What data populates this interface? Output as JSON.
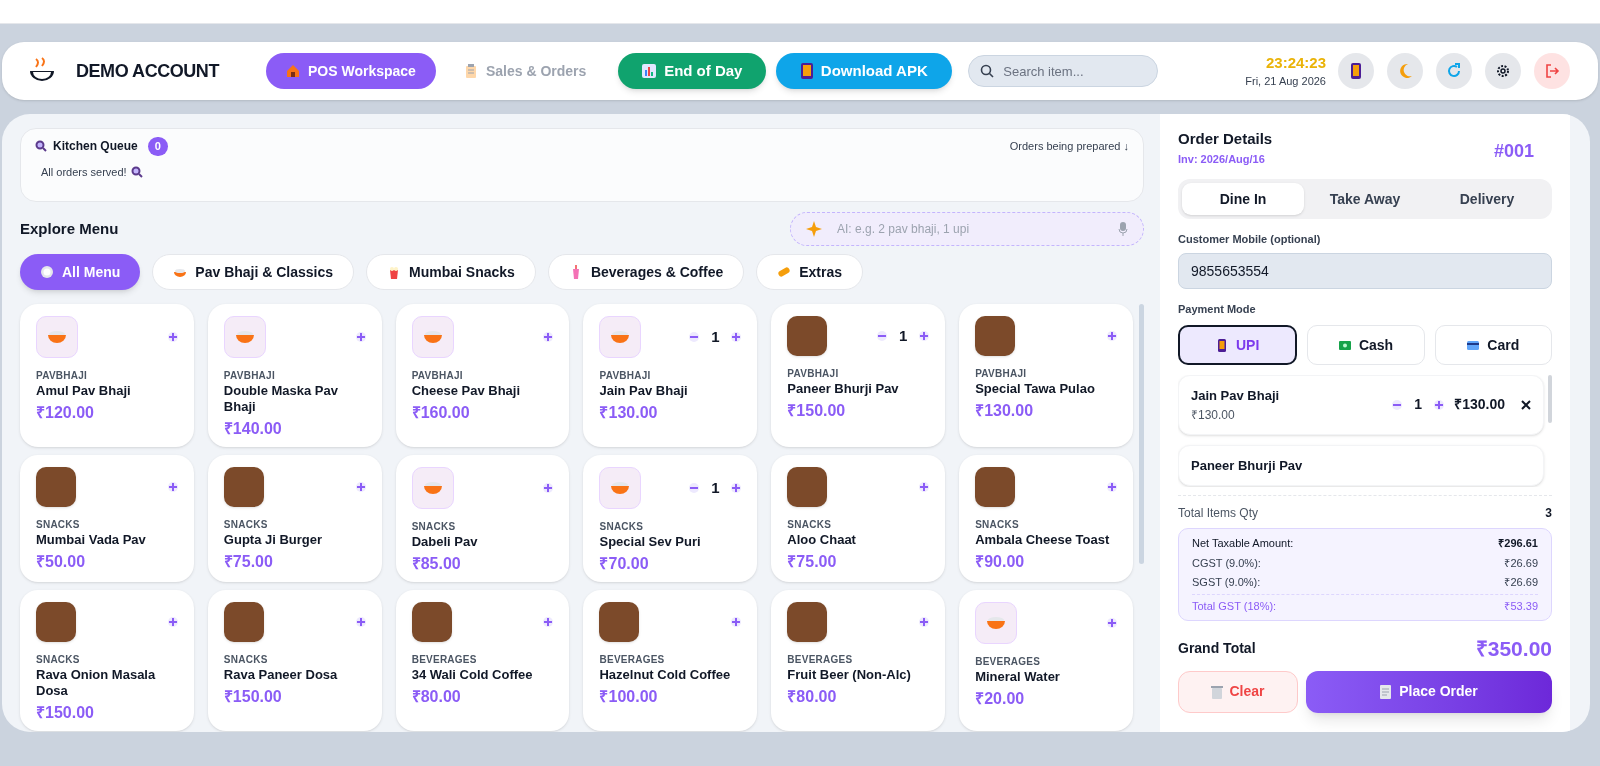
{
  "header": {
    "account_name": "DEMO ACCOUNT",
    "nav": [
      {
        "label": "POS Workspace",
        "selected": true
      },
      {
        "label": "Sales & Orders",
        "selected": false
      }
    ],
    "actions": [
      {
        "label": "End of Day",
        "kind": "green"
      },
      {
        "label": "Download APK",
        "kind": "blue"
      }
    ],
    "search": {
      "placeholder": "Search item..."
    },
    "clock": {
      "time": "23:24:23",
      "date": "Fri, 21 Aug 2026"
    }
  },
  "kitchen_queue": {
    "title": "Kitchen Queue",
    "count": "0",
    "status": "All orders served!",
    "hint": "Orders being prepared ↓"
  },
  "menu": {
    "title": "Explore Menu",
    "ai_input": {
      "placeholder": "AI: e.g. 2 pav bhaji, 1 upi"
    },
    "categories": [
      {
        "label": "All Menu",
        "selected": true
      },
      {
        "label": "Pav Bhaji & Classics",
        "selected": false
      },
      {
        "label": "Mumbai Snacks",
        "selected": false
      },
      {
        "label": "Beverages & Coffee",
        "selected": false
      },
      {
        "label": "Extras",
        "selected": false
      }
    ],
    "items": [
      {
        "category": "PAVBHAJI",
        "name": "Amul Pav Bhaji",
        "price": "₹120.00",
        "kind": "icon"
      },
      {
        "category": "PAVBHAJI",
        "name": "Double Maska Pav Bhaji",
        "price": "₹140.00",
        "kind": "icon"
      },
      {
        "category": "PAVBHAJI",
        "name": "Cheese Pav Bhaji",
        "price": "₹160.00",
        "kind": "icon"
      },
      {
        "category": "PAVBHAJI",
        "name": "Jain Pav Bhaji",
        "price": "₹130.00",
        "kind": "icon",
        "quantity": "1"
      },
      {
        "category": "PAVBHAJI",
        "name": "Paneer Bhurji Pav",
        "price": "₹150.00",
        "kind": "photo",
        "quantity": "1"
      },
      {
        "category": "PAVBHAJI",
        "name": "Special Tawa Pulao",
        "price": "₹130.00",
        "kind": "photo"
      },
      {
        "category": "SNACKS",
        "name": "Mumbai Vada Pav",
        "price": "₹50.00",
        "kind": "photo"
      },
      {
        "category": "SNACKS",
        "name": "Gupta Ji Burger",
        "price": "₹75.00",
        "kind": "photo"
      },
      {
        "category": "SNACKS",
        "name": "Dabeli Pav",
        "price": "₹85.00",
        "kind": "icon"
      },
      {
        "category": "SNACKS",
        "name": "Special Sev Puri",
        "price": "₹70.00",
        "kind": "icon",
        "quantity": "1"
      },
      {
        "category": "SNACKS",
        "name": "Aloo Chaat",
        "price": "₹75.00",
        "kind": "photo"
      },
      {
        "category": "SNACKS",
        "name": "Ambala Cheese Toast",
        "price": "₹90.00",
        "kind": "photo"
      },
      {
        "category": "SNACKS",
        "name": "Rava Onion Masala Dosa",
        "price": "₹150.00",
        "kind": "photo"
      },
      {
        "category": "SNACKS",
        "name": "Rava Paneer Dosa",
        "price": "₹150.00",
        "kind": "photo"
      },
      {
        "category": "BEVERAGES",
        "name": "34 Wali Cold Coffee",
        "price": "₹80.00",
        "kind": "photo"
      },
      {
        "category": "BEVERAGES",
        "name": "Hazelnut Cold Coffee",
        "price": "₹100.00",
        "kind": "photo"
      },
      {
        "category": "BEVERAGES",
        "name": "Fruit Beer (Non-Alc)",
        "price": "₹80.00",
        "kind": "photo"
      },
      {
        "category": "BEVERAGES",
        "name": "Mineral Water",
        "price": "₹20.00",
        "kind": "icon"
      }
    ]
  },
  "order": {
    "title": "Order Details",
    "invoice": "Inv: 2026/Aug/16",
    "number": "#001",
    "order_types": [
      {
        "label": "Dine In",
        "selected": true
      },
      {
        "label": "Take Away",
        "selected": false
      },
      {
        "label": "Delivery",
        "selected": false
      }
    ],
    "mobile": {
      "label": "Customer Mobile (optional)",
      "value": "9855653554"
    },
    "payment": {
      "label": "Payment Mode",
      "modes": [
        {
          "label": "UPI",
          "selected": true
        },
        {
          "label": "Cash",
          "selected": false
        },
        {
          "label": "Card",
          "selected": false
        }
      ]
    },
    "cart": [
      {
        "name": "Jain Pav Bhaji",
        "unit_price": "₹130.00",
        "quantity": "1",
        "total": "₹130.00"
      },
      {
        "name": "Paneer Bhurji Pav"
      }
    ],
    "total_qty": {
      "label": "Total Items Qty",
      "value": "3"
    },
    "tax": [
      {
        "label": "Net Taxable Amount:",
        "value": "₹296.61",
        "kind": "net"
      },
      {
        "label": "CGST (9.0%):",
        "value": "₹26.69",
        "kind": "tax"
      },
      {
        "label": "SGST (9.0%):",
        "value": "₹26.69",
        "kind": "tax"
      },
      {
        "label": "Total GST (18%):",
        "value": "₹53.39",
        "kind": "total"
      }
    ],
    "grand_total": {
      "label": "Grand Total",
      "value": "₹350.00"
    },
    "buttons": {
      "clear": "Clear",
      "place": "Place Order"
    }
  }
}
